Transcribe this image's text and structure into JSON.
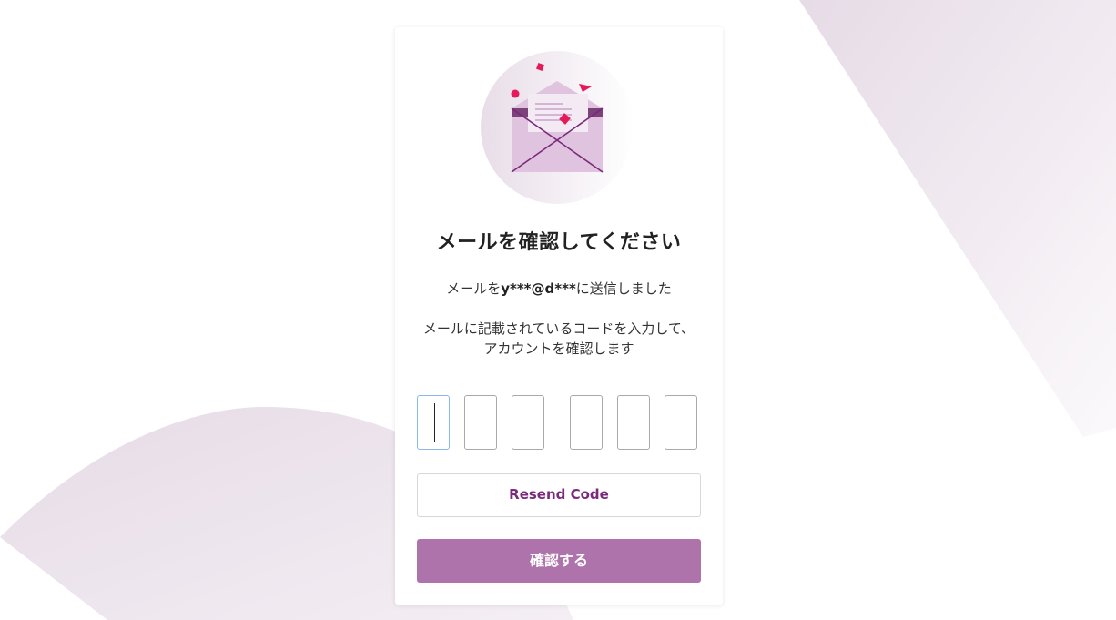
{
  "page": {
    "title": "メールを確認してください",
    "sent_prefix": "メールを",
    "sent_email": "y***@d***",
    "sent_suffix": "に送信しました",
    "instruction": "メールに記載されているコードを入力して、アカウントを確認します"
  },
  "code_inputs": [
    {
      "value": "",
      "focused": true
    },
    {
      "value": "",
      "focused": false
    },
    {
      "value": "",
      "focused": false
    },
    {
      "value": "",
      "focused": false
    },
    {
      "value": "",
      "focused": false
    },
    {
      "value": "",
      "focused": false
    }
  ],
  "buttons": {
    "resend_label": "Resend Code",
    "confirm_label": "確認する"
  },
  "icons": {
    "hero": "open-envelope-icon"
  },
  "colors": {
    "accent": "#7a2a7a",
    "confirm_bg": "#ad73aa",
    "focus_border": "#8ab8ec",
    "confetti": "#e6195a",
    "envelope": "#dfc3df",
    "envelope_dark": "#6b2b68"
  }
}
